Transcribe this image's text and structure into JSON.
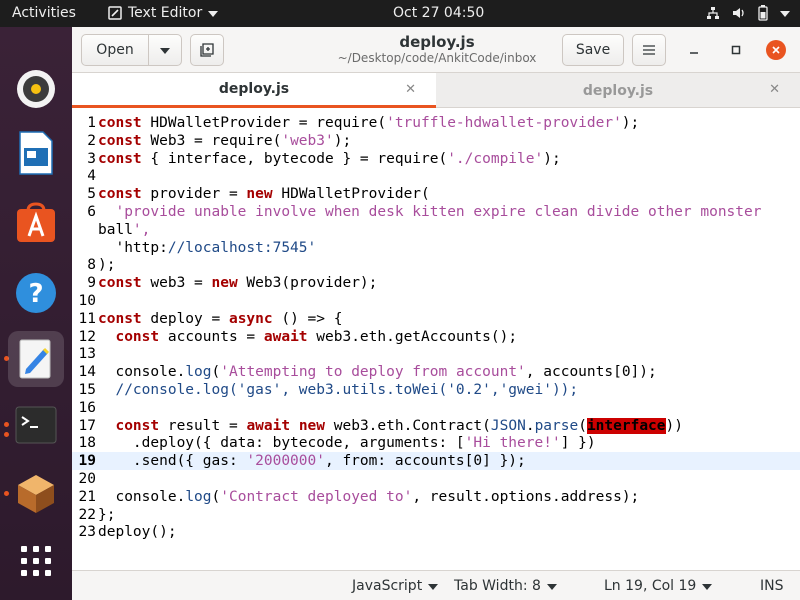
{
  "topbar": {
    "activities": "Activities",
    "app_name": "Text Editor",
    "clock": "Oct 27  04:50"
  },
  "dock": {
    "items": [
      "rhythmbox-icon",
      "libreoffice-impress-icon",
      "ubuntu-software-icon",
      "help-icon",
      "text-editor-icon",
      "terminal-icon",
      "app-icon",
      "show-applications-icon"
    ]
  },
  "header": {
    "open_label": "Open",
    "title": "deploy.js",
    "subtitle": "~/Desktop/code/AnkitCode/inbox",
    "save_label": "Save"
  },
  "tabs": [
    {
      "label": "deploy.js",
      "active": true
    },
    {
      "label": "deploy.js",
      "active": false
    }
  ],
  "editor": {
    "current_line": 19,
    "lines": [
      {
        "n": "1",
        "code": "const HDWalletProvider = require('truffle-hdwallet-provider');"
      },
      {
        "n": "2",
        "code": "const Web3 = require('web3');"
      },
      {
        "n": "3",
        "code": "const { interface, bytecode } = require('./compile');"
      },
      {
        "n": "4",
        "code": ""
      },
      {
        "n": "5",
        "code": "const provider = new HDWalletProvider("
      },
      {
        "n": "6",
        "code": "  'provide unable involve when desk kitten expire clean divide other monster"
      },
      {
        "n": "",
        "code": "ball',"
      },
      {
        "n": "",
        "code": "  'http://localhost:7545'"
      },
      {
        "n": "8",
        "code": ");"
      },
      {
        "n": "9",
        "code": "const web3 = new Web3(provider);"
      },
      {
        "n": "10",
        "code": ""
      },
      {
        "n": "11",
        "code": "const deploy = async () => {"
      },
      {
        "n": "12",
        "code": "  const accounts = await web3.eth.getAccounts();"
      },
      {
        "n": "13",
        "code": ""
      },
      {
        "n": "14",
        "code": "  console.log('Attempting to deploy from account', accounts[0]);"
      },
      {
        "n": "15",
        "code": "  //console.log('gas', web3.utils.toWei('0.2','gwei'));"
      },
      {
        "n": "16",
        "code": ""
      },
      {
        "n": "17",
        "code": "  const result = await new web3.eth.Contract(JSON.parse(interface))"
      },
      {
        "n": "18",
        "code": "    .deploy({ data: bytecode, arguments: ['Hi there!'] })"
      },
      {
        "n": "19",
        "code": "    .send({ gas: '2000000', from: accounts[0] });"
      },
      {
        "n": "20",
        "code": ""
      },
      {
        "n": "21",
        "code": "  console.log('Contract deployed to', result.options.address);"
      },
      {
        "n": "22",
        "code": "};"
      },
      {
        "n": "23",
        "code": "deploy();"
      }
    ]
  },
  "statusbar": {
    "language": "JavaScript",
    "tab_width": "Tab Width: 8",
    "position": "Ln 19, Col 19",
    "mode": "INS"
  },
  "colors": {
    "accent": "#e95420",
    "keyword": "#a40000",
    "string": "#a84d9c",
    "builtin": "#204a87",
    "highlight": "#cc0000"
  }
}
